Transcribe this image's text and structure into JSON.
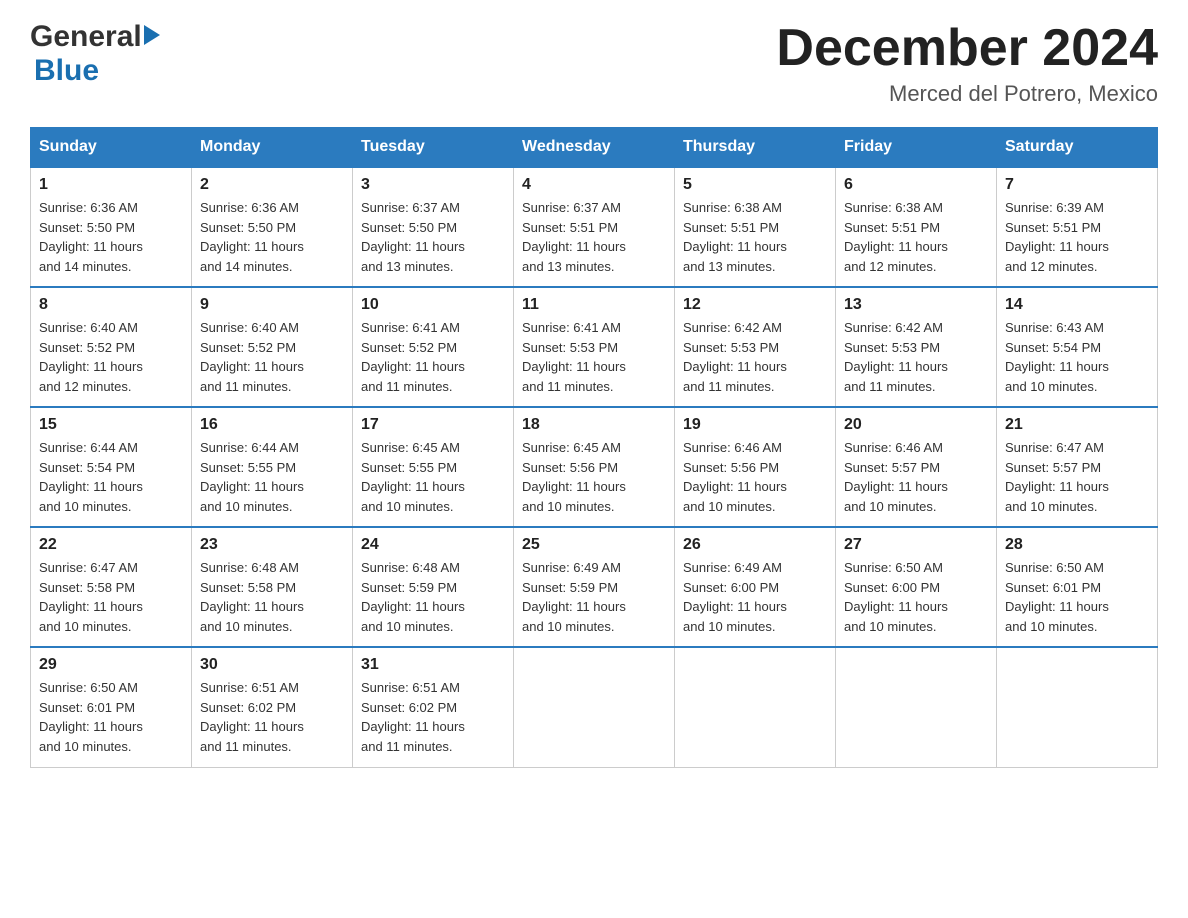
{
  "header": {
    "logo_general": "General",
    "logo_blue": "Blue",
    "month_title": "December 2024",
    "location": "Merced del Potrero, Mexico"
  },
  "days_of_week": [
    "Sunday",
    "Monday",
    "Tuesday",
    "Wednesday",
    "Thursday",
    "Friday",
    "Saturday"
  ],
  "weeks": [
    [
      {
        "day": "1",
        "sunrise": "6:36 AM",
        "sunset": "5:50 PM",
        "daylight": "11 hours and 14 minutes."
      },
      {
        "day": "2",
        "sunrise": "6:36 AM",
        "sunset": "5:50 PM",
        "daylight": "11 hours and 14 minutes."
      },
      {
        "day": "3",
        "sunrise": "6:37 AM",
        "sunset": "5:50 PM",
        "daylight": "11 hours and 13 minutes."
      },
      {
        "day": "4",
        "sunrise": "6:37 AM",
        "sunset": "5:51 PM",
        "daylight": "11 hours and 13 minutes."
      },
      {
        "day": "5",
        "sunrise": "6:38 AM",
        "sunset": "5:51 PM",
        "daylight": "11 hours and 13 minutes."
      },
      {
        "day": "6",
        "sunrise": "6:38 AM",
        "sunset": "5:51 PM",
        "daylight": "11 hours and 12 minutes."
      },
      {
        "day": "7",
        "sunrise": "6:39 AM",
        "sunset": "5:51 PM",
        "daylight": "11 hours and 12 minutes."
      }
    ],
    [
      {
        "day": "8",
        "sunrise": "6:40 AM",
        "sunset": "5:52 PM",
        "daylight": "11 hours and 12 minutes."
      },
      {
        "day": "9",
        "sunrise": "6:40 AM",
        "sunset": "5:52 PM",
        "daylight": "11 hours and 11 minutes."
      },
      {
        "day": "10",
        "sunrise": "6:41 AM",
        "sunset": "5:52 PM",
        "daylight": "11 hours and 11 minutes."
      },
      {
        "day": "11",
        "sunrise": "6:41 AM",
        "sunset": "5:53 PM",
        "daylight": "11 hours and 11 minutes."
      },
      {
        "day": "12",
        "sunrise": "6:42 AM",
        "sunset": "5:53 PM",
        "daylight": "11 hours and 11 minutes."
      },
      {
        "day": "13",
        "sunrise": "6:42 AM",
        "sunset": "5:53 PM",
        "daylight": "11 hours and 11 minutes."
      },
      {
        "day": "14",
        "sunrise": "6:43 AM",
        "sunset": "5:54 PM",
        "daylight": "11 hours and 10 minutes."
      }
    ],
    [
      {
        "day": "15",
        "sunrise": "6:44 AM",
        "sunset": "5:54 PM",
        "daylight": "11 hours and 10 minutes."
      },
      {
        "day": "16",
        "sunrise": "6:44 AM",
        "sunset": "5:55 PM",
        "daylight": "11 hours and 10 minutes."
      },
      {
        "day": "17",
        "sunrise": "6:45 AM",
        "sunset": "5:55 PM",
        "daylight": "11 hours and 10 minutes."
      },
      {
        "day": "18",
        "sunrise": "6:45 AM",
        "sunset": "5:56 PM",
        "daylight": "11 hours and 10 minutes."
      },
      {
        "day": "19",
        "sunrise": "6:46 AM",
        "sunset": "5:56 PM",
        "daylight": "11 hours and 10 minutes."
      },
      {
        "day": "20",
        "sunrise": "6:46 AM",
        "sunset": "5:57 PM",
        "daylight": "11 hours and 10 minutes."
      },
      {
        "day": "21",
        "sunrise": "6:47 AM",
        "sunset": "5:57 PM",
        "daylight": "11 hours and 10 minutes."
      }
    ],
    [
      {
        "day": "22",
        "sunrise": "6:47 AM",
        "sunset": "5:58 PM",
        "daylight": "11 hours and 10 minutes."
      },
      {
        "day": "23",
        "sunrise": "6:48 AM",
        "sunset": "5:58 PM",
        "daylight": "11 hours and 10 minutes."
      },
      {
        "day": "24",
        "sunrise": "6:48 AM",
        "sunset": "5:59 PM",
        "daylight": "11 hours and 10 minutes."
      },
      {
        "day": "25",
        "sunrise": "6:49 AM",
        "sunset": "5:59 PM",
        "daylight": "11 hours and 10 minutes."
      },
      {
        "day": "26",
        "sunrise": "6:49 AM",
        "sunset": "6:00 PM",
        "daylight": "11 hours and 10 minutes."
      },
      {
        "day": "27",
        "sunrise": "6:50 AM",
        "sunset": "6:00 PM",
        "daylight": "11 hours and 10 minutes."
      },
      {
        "day": "28",
        "sunrise": "6:50 AM",
        "sunset": "6:01 PM",
        "daylight": "11 hours and 10 minutes."
      }
    ],
    [
      {
        "day": "29",
        "sunrise": "6:50 AM",
        "sunset": "6:01 PM",
        "daylight": "11 hours and 10 minutes."
      },
      {
        "day": "30",
        "sunrise": "6:51 AM",
        "sunset": "6:02 PM",
        "daylight": "11 hours and 11 minutes."
      },
      {
        "day": "31",
        "sunrise": "6:51 AM",
        "sunset": "6:02 PM",
        "daylight": "11 hours and 11 minutes."
      },
      null,
      null,
      null,
      null
    ]
  ],
  "labels": {
    "sunrise": "Sunrise:",
    "sunset": "Sunset:",
    "daylight": "Daylight:"
  }
}
